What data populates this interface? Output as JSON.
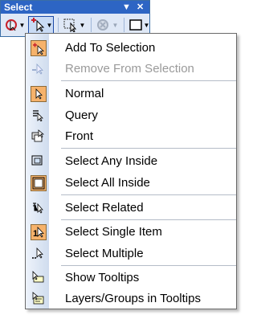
{
  "window": {
    "title": "Select",
    "dropdown_glyph": "▼",
    "close_glyph": "✕"
  },
  "toolbar": {
    "buttons": [
      {
        "name": "select-features-tool-icon"
      },
      {
        "name": "select-elements-tool-icon",
        "active": true
      },
      {
        "name": "select-rectangle-tool-icon"
      },
      {
        "name": "clear-selection-tool-icon",
        "disabled": true
      },
      {
        "name": "select-box-tool-icon"
      }
    ]
  },
  "menu": {
    "items": [
      {
        "label": "Add To Selection",
        "icon": "add-to-selection-icon",
        "highlighted": true
      },
      {
        "label": "Remove From Selection",
        "icon": "remove-from-selection-icon",
        "disabled": true
      },
      {
        "label": "Normal",
        "icon": "normal-pointer-icon",
        "highlighted": true
      },
      {
        "label": "Query",
        "icon": "query-icon"
      },
      {
        "label": "Front",
        "icon": "front-icon"
      },
      {
        "label": "Select Any Inside",
        "icon": "select-any-inside-icon"
      },
      {
        "label": "Select All Inside",
        "icon": "select-all-inside-icon",
        "highlighted": true
      },
      {
        "label": "Select Related",
        "icon": "select-related-icon"
      },
      {
        "label": "Select Single Item",
        "icon": "select-single-item-icon",
        "highlighted": true
      },
      {
        "label": "Select Multiple",
        "icon": "select-multiple-icon"
      },
      {
        "label": "Show Tooltips",
        "icon": "show-tooltips-icon"
      },
      {
        "label": "Layers/Groups in Tooltips",
        "icon": "layers-groups-tooltips-icon"
      }
    ]
  },
  "colors": {
    "title_bar": "#2d65c4",
    "highlight_icon_bg": "#f6b26b",
    "menu_border": "#6a6a6a",
    "disabled_text": "#9a9a9a"
  }
}
